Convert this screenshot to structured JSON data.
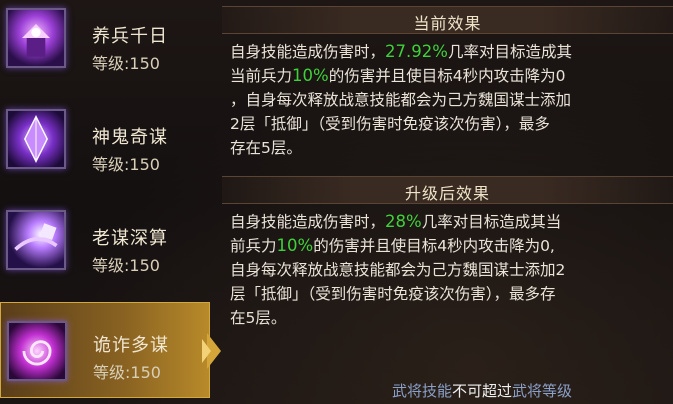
{
  "skills": [
    {
      "name": "养兵千日",
      "level": "等级:150",
      "icon": "purple-palace-icon"
    },
    {
      "name": "神鬼奇谋",
      "level": "等级:150",
      "icon": "purple-crystal-icon"
    },
    {
      "name": "老谋深算",
      "level": "等级:150",
      "icon": "purple-dice-icon"
    },
    {
      "name": "诡诈多谋",
      "level": "等级:150",
      "icon": "purple-swirl-icon"
    }
  ],
  "current": {
    "title": "当前效果",
    "lines": [
      {
        "pre": "自身技能造成伤害时，",
        "hl": "27.92%",
        "post": "几率对目标造成其"
      },
      {
        "pre": "当前兵力",
        "hl": "10%",
        "post": "的伤害并且使目标4秒内攻击降为0"
      },
      {
        "pre": "，自身每次释放战意技能都会为己方魏国谋士添加",
        "hl": "",
        "post": ""
      },
      {
        "pre": "2层「抵御」（受到伤害时免疫该次伤害），最多",
        "hl": "",
        "post": ""
      },
      {
        "pre": "存在5层。",
        "hl": "",
        "post": ""
      }
    ]
  },
  "upgrade": {
    "title": "升级后效果",
    "lines": [
      {
        "pre": "自身技能造成伤害时，",
        "hl": "28%",
        "post": "几率对目标造成其当"
      },
      {
        "pre": "前兵力",
        "hl": "10%",
        "post": "的伤害并且使目标4秒内攻击降为0,"
      },
      {
        "pre": "自身每次释放战意技能都会为己方魏国谋士添加2",
        "hl": "",
        "post": ""
      },
      {
        "pre": "层「抵御」（受到伤害时免疫该次伤害），最多存",
        "hl": "",
        "post": ""
      },
      {
        "pre": "在5层。",
        "hl": "",
        "post": ""
      }
    ]
  },
  "footer": {
    "part1": "武将技能",
    "part2": "不可超过",
    "part3": "武将等级"
  }
}
